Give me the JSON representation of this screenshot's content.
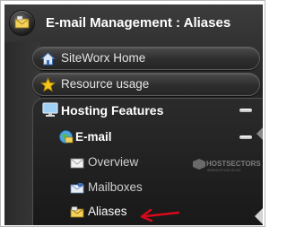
{
  "header": {
    "title": "E-mail Management : Aliases",
    "icon": "email-management-icon"
  },
  "nav": {
    "items": [
      {
        "label": "SiteWorx Home",
        "icon": "home-icon"
      },
      {
        "label": "Resource usage",
        "icon": "star-icon"
      }
    ],
    "hosting_features": {
      "label": "Hosting Features",
      "icon": "monitor-icon",
      "email": {
        "label": "E-mail",
        "icon": "globe-mail-icon",
        "children": [
          {
            "label": "Overview",
            "icon": "envelope-icon"
          },
          {
            "label": "Mailboxes",
            "icon": "mailbox-icon"
          },
          {
            "label": "Aliases",
            "icon": "alias-envelope-icon",
            "active": true
          }
        ]
      }
    }
  },
  "watermark": {
    "brand": "HOSTSECTORS",
    "tagline": "WEBHOSTING BLOG"
  },
  "colors": {
    "accent": "#d8091a",
    "panel_dark": "#1c1c1c"
  }
}
